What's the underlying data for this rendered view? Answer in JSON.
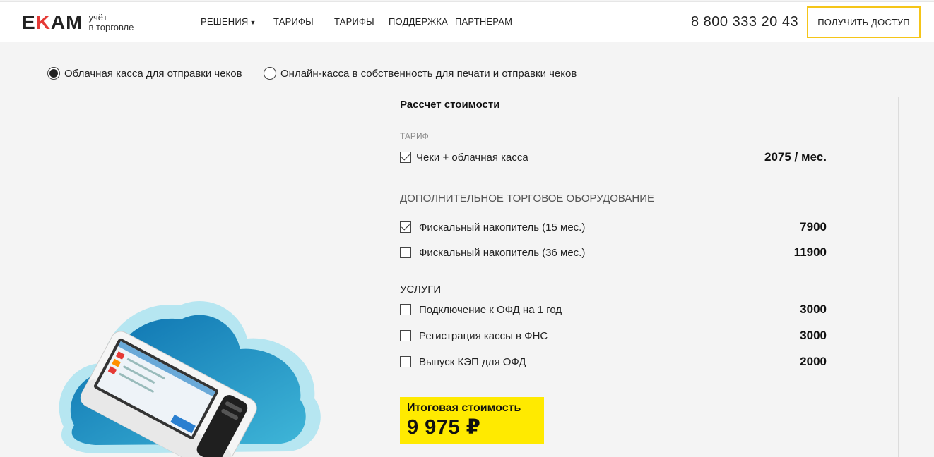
{
  "header": {
    "logo_text": "EKAM",
    "logo_tagline_1": "учёт",
    "logo_tagline_2": "в торговле",
    "nav": [
      {
        "label": "РЕШЕНИЯ",
        "has_dropdown": true
      },
      {
        "label": "ТАРИФЫ"
      },
      {
        "label": "ТАРИФЫ"
      },
      {
        "label": "ПОДДЕРЖКА"
      },
      {
        "label": "ПАРТНЕРАМ"
      }
    ],
    "phone": "8 800 333 20 43",
    "cta_label": "ПОЛУЧИТЬ ДОСТУП"
  },
  "mode": {
    "options": [
      {
        "label": "Облачная касса для отправки чеков",
        "selected": true
      },
      {
        "label": "Онлайн-касса в собственность для печати и отправки чеков",
        "selected": false
      }
    ]
  },
  "calc": {
    "title": "Рассчет стоимости",
    "tariff_heading": "ТАРИФ",
    "tariff": {
      "label": "Чеки + облачная касса",
      "price": "2075 / мес.",
      "checked": true
    },
    "equipment_heading": "ДОПОЛНИТЕЛЬНОЕ ТОРГОВОЕ ОБОРУДОВАНИЕ",
    "equipment": [
      {
        "label": "Фискальный накопитель (15 мес.)",
        "price": "7900",
        "checked": true
      },
      {
        "label": "Фискальный накопитель (36 мес.)",
        "price": "11900",
        "checked": false
      }
    ],
    "services_heading": "УСЛУГИ",
    "services": [
      {
        "label": "Подключение к ОФД на 1 год",
        "price": "3000",
        "checked": false
      },
      {
        "label": "Регистрация кассы в ФНС",
        "price": "3000",
        "checked": false
      },
      {
        "label": "Выпуск КЭП для ОФД",
        "price": "2000",
        "checked": false
      }
    ],
    "total_label": "Итоговая стоимость",
    "total_value": "9 975 ₽"
  },
  "colors": {
    "accent_yellow": "#ffea00",
    "cta_border": "#f5c518",
    "logo_red": "#e53935",
    "cloud_blue": "#1e88c8",
    "cloud_outer": "#b3e5f0"
  },
  "icons": {
    "terminal": "pos-terminal-illustration",
    "cloud": "cloud-illustration"
  }
}
